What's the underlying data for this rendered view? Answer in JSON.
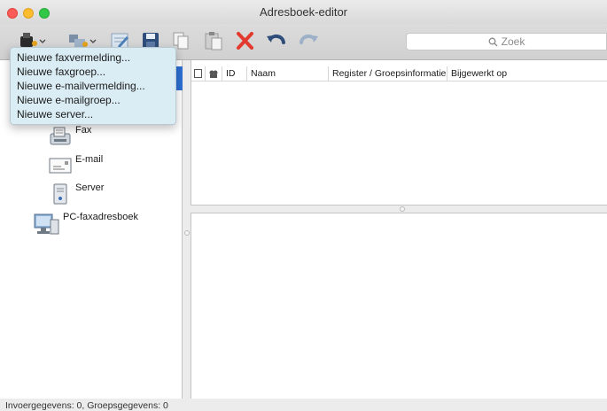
{
  "window": {
    "title": "Adresboek-editor"
  },
  "toolbar": {
    "icons": [
      "new-entry-icon",
      "new-group-icon",
      "edit-icon",
      "save-icon",
      "copy-icon",
      "paste-icon",
      "delete-icon",
      "undo-icon",
      "redo-icon"
    ],
    "search_placeholder": "Zoek"
  },
  "menu": {
    "items": [
      "Nieuwe faxvermelding...",
      "Nieuwe faxgroep...",
      "Nieuwe e-mailvermelding...",
      "Nieuwe e-mailgroep...",
      "Nieuwe server..."
    ]
  },
  "sidebar": {
    "items": [
      {
        "label": "Fax",
        "icon": "fax-icon"
      },
      {
        "label": "E-mail",
        "icon": "email-icon"
      },
      {
        "label": "Server",
        "icon": "server-icon"
      },
      {
        "label": "PC-faxadresboek",
        "icon": "pc-fax-addressbook-icon"
      }
    ]
  },
  "list": {
    "columns": [
      "ID",
      "Naam",
      "Register / Groepsinformatie",
      "Bijgewerkt op"
    ]
  },
  "status": {
    "text": "Invoergegevens: 0, Groepsgegevens: 0"
  },
  "colors": {
    "accent": "#2d6fd2",
    "menu_bg": "#daecf4",
    "delete_red": "#e23a2e"
  }
}
